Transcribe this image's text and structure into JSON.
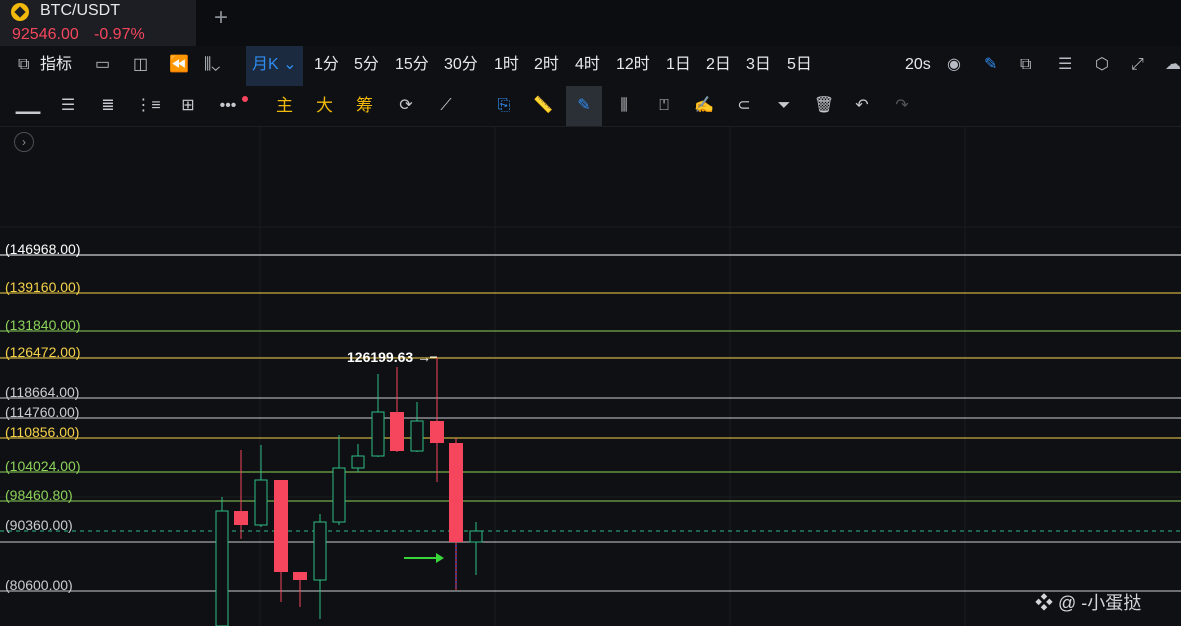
{
  "tab": {
    "symbol": "BTC/USDT",
    "price": "92546.00",
    "change": "-0.97%",
    "add_icon": "+"
  },
  "toolbar1": {
    "indicators": "指标",
    "intervals_selected": "月K",
    "intervals": [
      "1分",
      "5分",
      "15分",
      "30分",
      "1时",
      "2时",
      "4时",
      "12时",
      "1日",
      "2日",
      "3日",
      "5日"
    ],
    "refresh": "20s"
  },
  "toolbar2": {
    "main": "主",
    "big": "大",
    "chips": "筹"
  },
  "chart": {
    "annotation": "126199.63 →",
    "watermark": "@ -小蛋挞",
    "levels": [
      {
        "label": "(146968.00)",
        "color": "#ffffff"
      },
      {
        "label": "(139160.00)",
        "color": "#f5d24a"
      },
      {
        "label": "(131840.00)",
        "color": "#8bd25a"
      },
      {
        "label": "(126472.00)",
        "color": "#f5d24a"
      },
      {
        "label": "(118664.00)",
        "color": "#c9cdd2"
      },
      {
        "label": "(114760.00)",
        "color": "#c9cdd2"
      },
      {
        "label": "(110856.00)",
        "color": "#f5d24a"
      },
      {
        "label": "(104024.00)",
        "color": "#8bd25a"
      },
      {
        "label": "(98460.80)",
        "color": "#8bd25a"
      },
      {
        "label": "(90360.00)",
        "color": "#c9cdd2"
      },
      {
        "label": "(80600.00)",
        "color": "#c9cdd2"
      }
    ]
  },
  "colors": {
    "up": "#2ebd85",
    "down": "#f6465d",
    "accent": "#2f8cf0"
  }
}
